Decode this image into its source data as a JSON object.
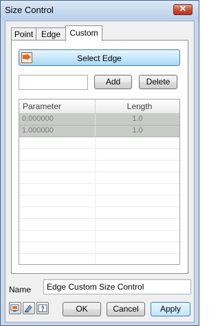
{
  "window": {
    "title": "Size Control"
  },
  "tabs": [
    {
      "label": "Point"
    },
    {
      "label": "Edge"
    },
    {
      "label": "Custom"
    }
  ],
  "custom": {
    "select_edge_label": "Select Edge",
    "parameter_input_value": "",
    "add_label": "Add",
    "delete_label": "Delete",
    "grid": {
      "columns": [
        "Parameter",
        "Length"
      ],
      "rows": [
        {
          "parameter": "0.000000",
          "length": "1.0"
        },
        {
          "parameter": "1.000000",
          "length": "1.0"
        }
      ]
    }
  },
  "name": {
    "label": "Name",
    "value": "Edge Custom Size Control"
  },
  "buttons": {
    "ok": "OK",
    "cancel": "Cancel",
    "apply": "Apply"
  },
  "colors": {
    "title_bar": "#c7d8ec",
    "close_button": "#c84a30",
    "grid_row": "#c9cbc9",
    "accent": "#3c7fb1"
  }
}
